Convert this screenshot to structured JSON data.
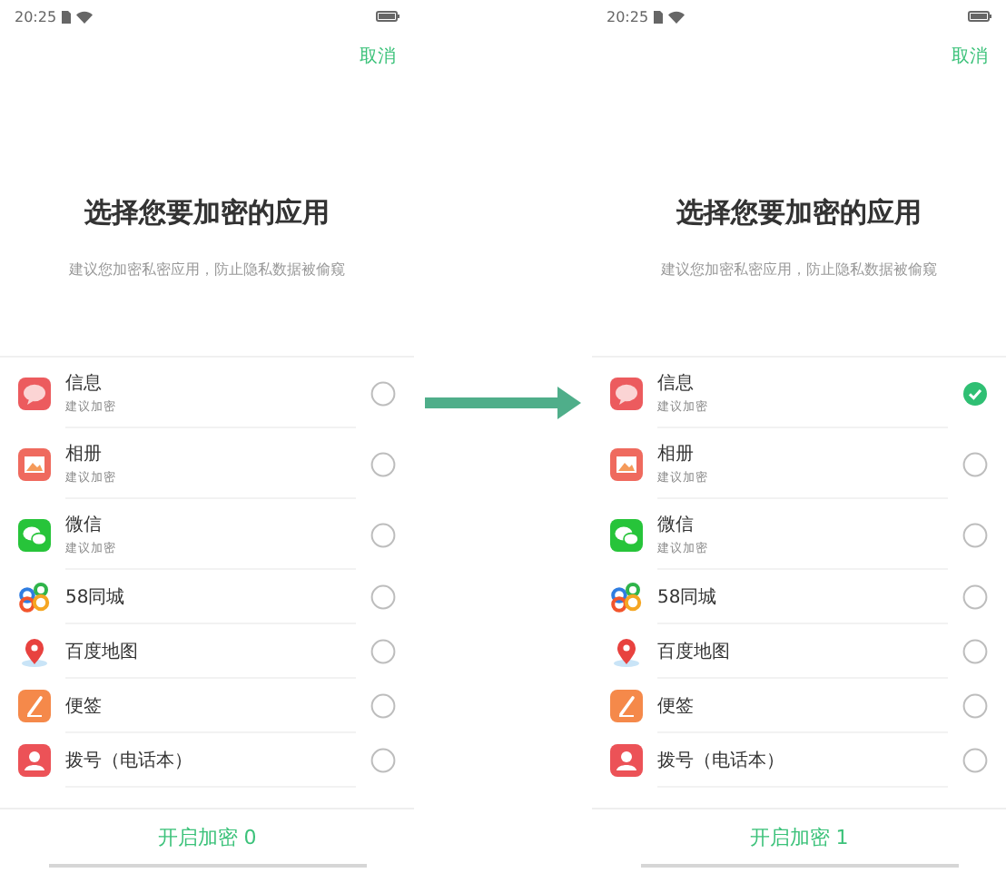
{
  "screens": [
    {
      "status_bar": {
        "time": "20:25"
      },
      "cancel": "取消",
      "title": "选择您要加密的应用",
      "subtitle": "建议您加密私密应用，防止隐私数据被偷窥",
      "apps": [
        {
          "name": "信息",
          "note": "建议加密",
          "selected": false
        },
        {
          "name": "相册",
          "note": "建议加密",
          "selected": false
        },
        {
          "name": "微信",
          "note": "建议加密",
          "selected": false
        },
        {
          "name": "58同城",
          "selected": false
        },
        {
          "name": "百度地图",
          "selected": false
        },
        {
          "name": "便签",
          "selected": false
        },
        {
          "name": "拨号（电话本）",
          "selected": false
        }
      ],
      "action": "开启加密 0"
    },
    {
      "status_bar": {
        "time": "20:25"
      },
      "cancel": "取消",
      "title": "选择您要加密的应用",
      "subtitle": "建议您加密私密应用，防止隐私数据被偷窥",
      "apps": [
        {
          "name": "信息",
          "note": "建议加密",
          "selected": true
        },
        {
          "name": "相册",
          "note": "建议加密",
          "selected": false
        },
        {
          "name": "微信",
          "note": "建议加密",
          "selected": false
        },
        {
          "name": "58同城",
          "selected": false
        },
        {
          "name": "百度地图",
          "selected": false
        },
        {
          "name": "便签",
          "selected": false
        },
        {
          "name": "拨号（电话本）",
          "selected": false
        }
      ],
      "action": "开启加密 1"
    }
  ]
}
